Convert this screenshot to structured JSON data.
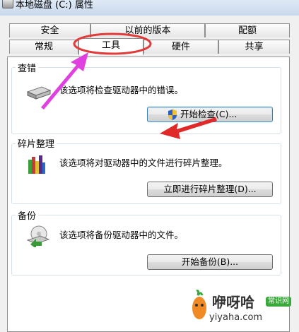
{
  "window": {
    "title": "本地磁盘 (C:) 属性"
  },
  "tabs": {
    "row1": [
      "安全",
      "以前的版本",
      "配额"
    ],
    "row2": [
      "常规",
      "工具",
      "硬件",
      "共享"
    ],
    "active": "工具"
  },
  "error_check": {
    "title": "查错",
    "description": "该选项将检查驱动器中的错误。",
    "button": "开始检查(C)..."
  },
  "defrag": {
    "title": "碎片整理",
    "description": "该选项将对驱动器中的文件进行碎片整理。",
    "button": "立即进行碎片整理(D)..."
  },
  "backup": {
    "title": "备份",
    "description": "该选项将备份驱动器中的文件。",
    "button": "开始备份(B)..."
  },
  "watermark": {
    "name": "咿呀哈",
    "badge": "常识网",
    "url": "yiyaha.com"
  },
  "colors": {
    "annotation_ellipse": "#e03a3a",
    "annotation_arrow_left": "#e040e0",
    "annotation_arrow_right": "#e02a2a"
  }
}
